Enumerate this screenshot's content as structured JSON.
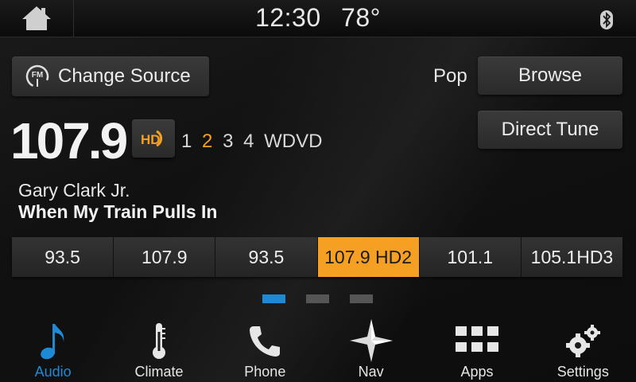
{
  "status_bar": {
    "time": "12:30",
    "temperature": "78°"
  },
  "source": {
    "change_source_label": "Change Source",
    "source_icon_text": "FM"
  },
  "genre": "Pop",
  "buttons": {
    "browse": "Browse",
    "direct_tune": "Direct Tune"
  },
  "station": {
    "frequency": "107.9",
    "hd_label": "HD",
    "subchannels": [
      "1",
      "2",
      "3",
      "4"
    ],
    "active_subchannel": "2",
    "call_sign": "WDVD"
  },
  "now_playing": {
    "artist": "Gary Clark Jr.",
    "song": "When My Train Pulls In"
  },
  "presets": [
    "93.5",
    "107.9",
    "93.5",
    "107.9 HD2",
    "101.1",
    "105.1HD3"
  ],
  "active_preset_index": 3,
  "page_indicator": {
    "pages": 3,
    "active": 1
  },
  "nav": [
    {
      "label": "Audio",
      "icon": "music-note-icon",
      "active": true
    },
    {
      "label": "Climate",
      "icon": "thermometer-icon",
      "active": false
    },
    {
      "label": "Phone",
      "icon": "phone-icon",
      "active": false
    },
    {
      "label": "Nav",
      "icon": "compass-star-icon",
      "active": false
    },
    {
      "label": "Apps",
      "icon": "apps-grid-icon",
      "active": false
    },
    {
      "label": "Settings",
      "icon": "gears-icon",
      "active": false
    }
  ],
  "colors": {
    "accent": "#f5a023",
    "active_blue": "#1e8ad6"
  }
}
